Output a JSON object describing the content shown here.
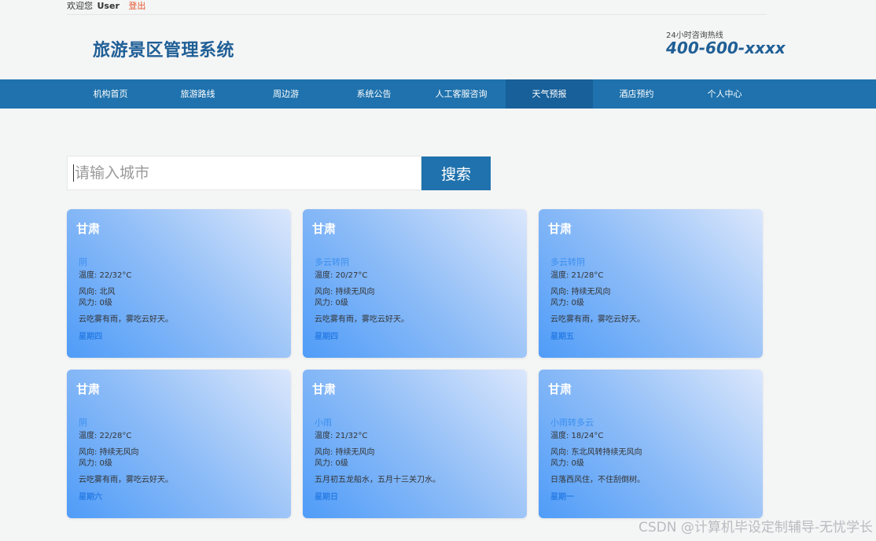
{
  "topbar": {
    "welcome": "欢迎您",
    "user": "User",
    "logout": "登出"
  },
  "header": {
    "title": "旅游景区管理系统",
    "hotline_label": "24小时咨询热线",
    "hotline": "400-600-xxxx"
  },
  "nav": {
    "items": [
      {
        "label": "机构首页"
      },
      {
        "label": "旅游路线"
      },
      {
        "label": "周边游"
      },
      {
        "label": "系统公告"
      },
      {
        "label": "人工客服咨询"
      },
      {
        "label": "天气预报"
      },
      {
        "label": "酒店预约"
      },
      {
        "label": "个人中心"
      }
    ],
    "active": "天气预报"
  },
  "search": {
    "placeholder": "请输入城市",
    "button": "搜索"
  },
  "cards": [
    {
      "city": "甘肃",
      "weather": "阴",
      "temp": "温度: 22/32°C",
      "wind_dir": "风向: 北风",
      "wind_power": "风力: 0级",
      "desc": "云吃雾有雨，雾吃云好天。",
      "weekday": "星期四"
    },
    {
      "city": "甘肃",
      "weather": "多云转阴",
      "temp": "温度: 20/27°C",
      "wind_dir": "风向: 持续无风向",
      "wind_power": "风力: 0级",
      "desc": "云吃雾有雨，雾吃云好天。",
      "weekday": "星期四"
    },
    {
      "city": "甘肃",
      "weather": "多云转阴",
      "temp": "温度: 21/28°C",
      "wind_dir": "风向: 持续无风向",
      "wind_power": "风力: 0级",
      "desc": "云吃雾有雨，雾吃云好天。",
      "weekday": "星期五"
    },
    {
      "city": "甘肃",
      "weather": "阴",
      "temp": "温度: 22/28°C",
      "wind_dir": "风向: 持续无风向",
      "wind_power": "风力: 0级",
      "desc": "云吃雾有雨，雾吃云好天。",
      "weekday": "星期六"
    },
    {
      "city": "甘肃",
      "weather": "小雨",
      "temp": "温度: 21/32°C",
      "wind_dir": "风向: 持续无风向",
      "wind_power": "风力: 0级",
      "desc": "五月初五龙船水，五月十三关刀水。",
      "weekday": "星期日"
    },
    {
      "city": "甘肃",
      "weather": "小雨转多云",
      "temp": "温度: 18/24°C",
      "wind_dir": "风向: 东北风转持续无风向",
      "wind_power": "风力: 0级",
      "desc": "日落西风住，不住刮倒树。",
      "weekday": "星期一"
    }
  ],
  "watermark": "CSDN @计算机毕设定制辅导-无忧学长"
}
